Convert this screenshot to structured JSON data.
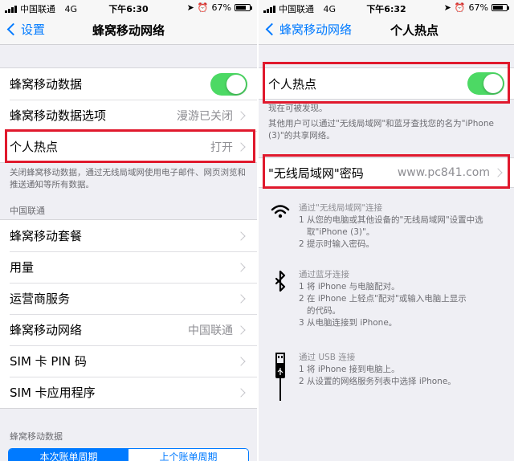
{
  "left": {
    "status": {
      "carrier": "中国联通",
      "network": "4G",
      "time": "下午6:30",
      "battery": "67%"
    },
    "nav": {
      "back_label": "设置",
      "title": "蜂窝移动网络"
    },
    "rows1": [
      {
        "label": "蜂窝移动数据",
        "value": ""
      },
      {
        "label": "蜂窝移动数据选项",
        "value": "漫游已关闭"
      },
      {
        "label": "个人热点",
        "value": "打开"
      }
    ],
    "footer_note": "关闭蜂窝移动数据，通过无线局域网使用电子邮件、网页浏览和推送通知等所有数据。",
    "section_header": "中国联通",
    "rows2": [
      {
        "label": "蜂窝移动套餐",
        "value": ""
      },
      {
        "label": "用量",
        "value": ""
      },
      {
        "label": "运营商服务",
        "value": ""
      },
      {
        "label": "蜂窝移动网络",
        "value": "中国联通"
      },
      {
        "label": "SIM 卡 PIN 码",
        "value": ""
      },
      {
        "label": "SIM 卡应用程序",
        "value": ""
      }
    ],
    "section_header2": "蜂窝移动数据",
    "segments": [
      "本次账单周期",
      "上个账单周期"
    ]
  },
  "right": {
    "status": {
      "carrier": "中国联通",
      "network": "4G",
      "time": "下午6:32",
      "battery": "67%"
    },
    "nav": {
      "back_label": "蜂窝移动网络",
      "title": "个人热点"
    },
    "hotspot_label": "个人热点",
    "note_discoverable": "现在可被发现。",
    "note_others": "其他用户可以通过\"无线局域网\"和蓝牙查找您的名为\"iPhone (3)\"的共享网络。",
    "password": {
      "label": "\"无线局域网\"密码",
      "value": "www.pc841.com"
    },
    "instructions": {
      "wifi": {
        "title": "通过\"无线局域网\"连接",
        "step1": "1 从您的电脑或其他设备的\"无线局域网\"设置中选",
        "step1b": "取\"iPhone (3)\"。",
        "step2": "2 提示时输入密码。"
      },
      "bluetooth": {
        "title": "通过蓝牙连接",
        "step1": "1 将 iPhone 与电脑配对。",
        "step2": "2 在 iPhone 上轻点\"配对\"或输入电脑上显示",
        "step2b": "的代码。",
        "step3": "3 从电脑连接到 iPhone。"
      },
      "usb": {
        "title": "通过 USB 连接",
        "step1": "1 将 iPhone 接到电脑上。",
        "step2": "2 从设置的网络服务列表中选择 iPhone。"
      }
    }
  },
  "colors": {
    "accent": "#007aff",
    "toggle_on": "#4cd964",
    "highlight": "#e0192d"
  }
}
